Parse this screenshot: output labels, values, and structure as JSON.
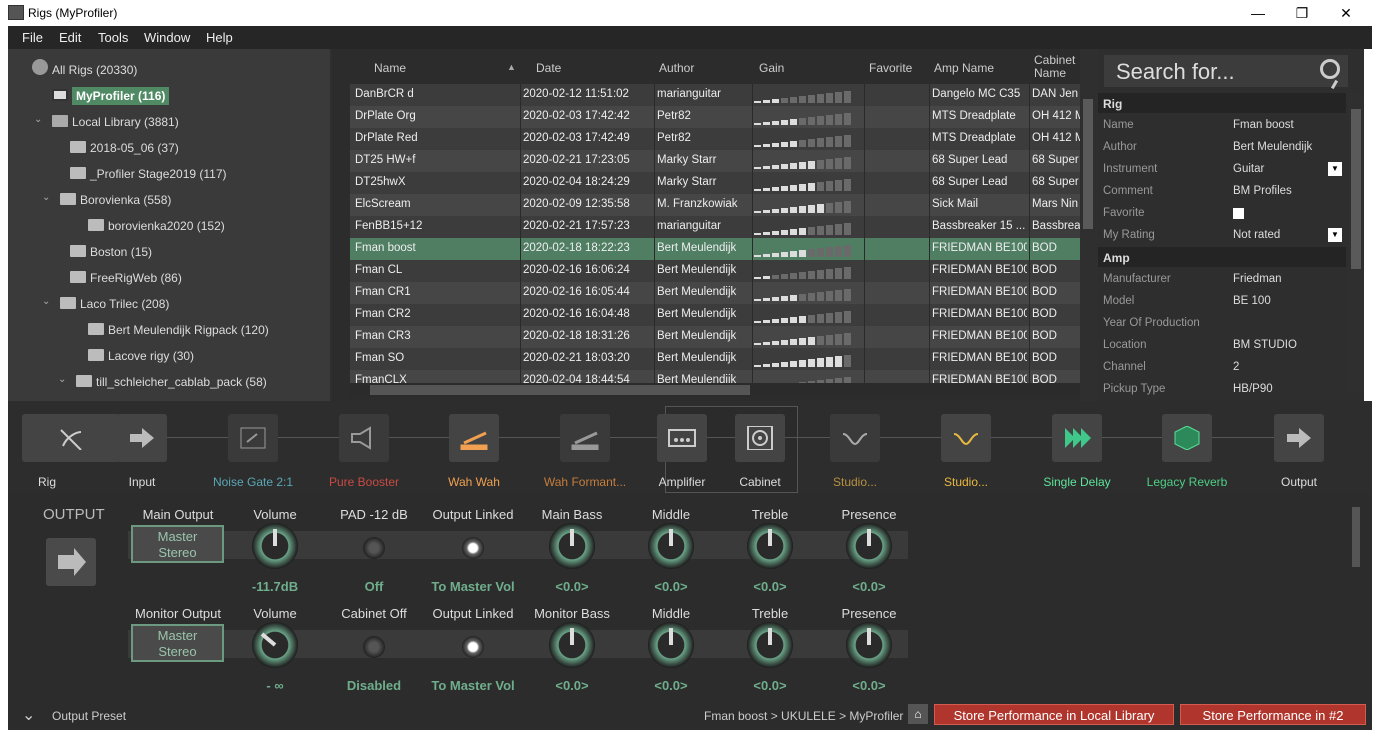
{
  "window": {
    "title": "Rigs (MyProfiler)",
    "minimize": "—",
    "maximize": "❐",
    "close": "✕"
  },
  "menu": [
    "File",
    "Edit",
    "Tools",
    "Window",
    "Help"
  ],
  "tree": [
    {
      "label": "All Rigs (20330)",
      "icon": "globe-icon"
    },
    {
      "label": "MyProfiler (116)",
      "icon": "profiler-icon",
      "selected": true
    },
    {
      "label": "Local Library (3881)",
      "icon": "laptop-icon"
    },
    {
      "label": "2018-05_06 (37)",
      "icon": "folder-icon"
    },
    {
      "label": "_Profiler Stage2019 (117)",
      "icon": "folder-icon"
    },
    {
      "label": "Borovienka (558)",
      "icon": "folder-icon"
    },
    {
      "label": "borovienka2020 (152)",
      "icon": "folder-icon"
    },
    {
      "label": "Boston (15)",
      "icon": "folder-icon"
    },
    {
      "label": "FreeRigWeb (86)",
      "icon": "folder-icon"
    },
    {
      "label": "Laco Trilec (208)",
      "icon": "folder-icon"
    },
    {
      "label": "Bert Meulendijk Rigpack (120)",
      "icon": "folder-icon"
    },
    {
      "label": "Lacove rigy (30)",
      "icon": "folder-icon"
    },
    {
      "label": "till_schleicher_cablab_pack (58)",
      "icon": "folder-icon"
    }
  ],
  "grid": {
    "columns": [
      "Name",
      "Date",
      "Author",
      "Gain",
      "Favorite",
      "Amp Name",
      "Cabinet Name"
    ],
    "rows": [
      {
        "name": "DanBrCR d",
        "date": "2020-02-12 11:51:02",
        "author": "marianguitar",
        "gain": 3,
        "amp": "Dangelo MC C35",
        "cab": "DAN Jen"
      },
      {
        "name": "DrPlate Org",
        "date": "2020-02-03 17:42:42",
        "author": "Petr82",
        "gain": 5,
        "amp": "MTS Dreadplate",
        "cab": "OH 412 M"
      },
      {
        "name": "DrPlate Red",
        "date": "2020-02-03 17:42:49",
        "author": "Petr82",
        "gain": 5,
        "amp": "MTS Dreadplate",
        "cab": "OH 412 M"
      },
      {
        "name": "DT25 HW+f",
        "date": "2020-02-21 17:23:05",
        "author": "Marky Starr",
        "gain": 7,
        "amp": "68 Super Lead",
        "cab": "68 Super"
      },
      {
        "name": "DT25hwX",
        "date": "2020-02-04 18:24:29",
        "author": "Marky Starr",
        "gain": 7,
        "amp": "68 Super Lead",
        "cab": "68 Super"
      },
      {
        "name": "ElcScream",
        "date": "2020-02-09 12:35:58",
        "author": "M. Franzkowiak",
        "gain": 8,
        "amp": "Sick Mail",
        "cab": "Mars Nin"
      },
      {
        "name": "FenBB15+12",
        "date": "2020-02-21 17:57:23",
        "author": "marianguitar",
        "gain": 6,
        "amp": "Bassbreaker 15 ...",
        "cab": "Bassbrea"
      },
      {
        "name": "Fman boost",
        "date": "2020-02-18 18:22:23",
        "author": "Bert Meulendijk",
        "gain": 6,
        "amp": "FRIEDMAN BE100",
        "cab": "BOD"
      },
      {
        "name": "Fman CL",
        "date": "2020-02-16 16:06:24",
        "author": "Bert Meulendijk",
        "gain": 2,
        "amp": "FRIEDMAN BE100",
        "cab": "BOD"
      },
      {
        "name": "Fman CR1",
        "date": "2020-02-16 16:05:44",
        "author": "Bert Meulendijk",
        "gain": 5,
        "amp": "FRIEDMAN BE100",
        "cab": "BOD"
      },
      {
        "name": "Fman CR2",
        "date": "2020-02-16 16:04:48",
        "author": "Bert Meulendijk",
        "gain": 6,
        "amp": "FRIEDMAN BE100",
        "cab": "BOD"
      },
      {
        "name": "Fman CR3",
        "date": "2020-02-18 18:31:26",
        "author": "Bert Meulendijk",
        "gain": 7,
        "amp": "FRIEDMAN BE100",
        "cab": "BOD"
      },
      {
        "name": "Fman SO",
        "date": "2020-02-21 18:03:20",
        "author": "Bert Meulendijk",
        "gain": 10,
        "amp": "FRIEDMAN BE100",
        "cab": "BOD"
      },
      {
        "name": "FmanCLX",
        "date": "2020-02-04 18:44:54",
        "author": "Bert Meulendijk",
        "gain": 3,
        "amp": "FRIEDMAN BE100",
        "cab": "BOD"
      }
    ]
  },
  "search": {
    "placeholder": "Search for..."
  },
  "props": {
    "rig_header": "Rig",
    "rig": [
      {
        "k": "Name",
        "v": "Fman boost"
      },
      {
        "k": "Author",
        "v": "Bert Meulendijk"
      },
      {
        "k": "Instrument",
        "v": "Guitar"
      },
      {
        "k": "Comment",
        "v": "BM Profiles"
      },
      {
        "k": "Favorite",
        "v": ""
      },
      {
        "k": "My Rating",
        "v": "Not rated"
      }
    ],
    "amp_header": "Amp",
    "amp": [
      {
        "k": "Manufacturer",
        "v": "Friedman"
      },
      {
        "k": "Model",
        "v": "BE 100"
      },
      {
        "k": "Year Of Production",
        "v": ""
      },
      {
        "k": "Location",
        "v": "BM STUDIO"
      },
      {
        "k": "Channel",
        "v": "2"
      },
      {
        "k": "Pickup Type",
        "v": "HB/P90"
      }
    ]
  },
  "chain": [
    {
      "label": "Rig",
      "color": "#dddddd"
    },
    {
      "label": "Input",
      "color": "#dddddd"
    },
    {
      "label": "Noise Gate 2:1",
      "color": "#5aa7b5"
    },
    {
      "label": "Pure Booster",
      "color": "#c84b43"
    },
    {
      "label": "Wah Wah",
      "color": "#f0a050"
    },
    {
      "label": "Wah Formant...",
      "color": "#c57d3d"
    },
    {
      "label": "Amplifier",
      "color": "#dddddd"
    },
    {
      "label": "Cabinet",
      "color": "#dddddd"
    },
    {
      "label": "Studio...",
      "color": "#b89040"
    },
    {
      "label": "Studio...",
      "color": "#e8b840"
    },
    {
      "label": "Single Delay",
      "color": "#5ee39a"
    },
    {
      "label": "Legacy Reverb",
      "color": "#4ccf85"
    },
    {
      "label": "Output",
      "color": "#dddddd"
    }
  ],
  "output": {
    "title": "OUTPUT",
    "main": {
      "label": "Main Output",
      "preset": "Master\nStereo",
      "headers": [
        "Volume",
        "PAD -12 dB",
        "Output Linked",
        "Main Bass",
        "Middle",
        "Treble",
        "Presence"
      ],
      "values": [
        "-11.7dB",
        "Off",
        "To Master Vol",
        "<0.0>",
        "<0.0>",
        "<0.0>",
        "<0.0>"
      ]
    },
    "monitor": {
      "label": "Monitor Output",
      "preset": "Master\nStereo",
      "headers": [
        "Volume",
        "Cabinet Off",
        "Output Linked",
        "Monitor Bass",
        "Middle",
        "Treble",
        "Presence"
      ],
      "values": [
        "- ∞",
        "Disabled",
        "To Master Vol",
        "<0.0>",
        "<0.0>",
        "<0.0>",
        "<0.0>"
      ]
    }
  },
  "status": {
    "preset_label": "Output Preset",
    "breadcrumb": "Fman boost > UKULELE > MyProfiler",
    "store_local": "Store Performance in Local Library",
    "store_perf": "Store Performance in #2"
  }
}
